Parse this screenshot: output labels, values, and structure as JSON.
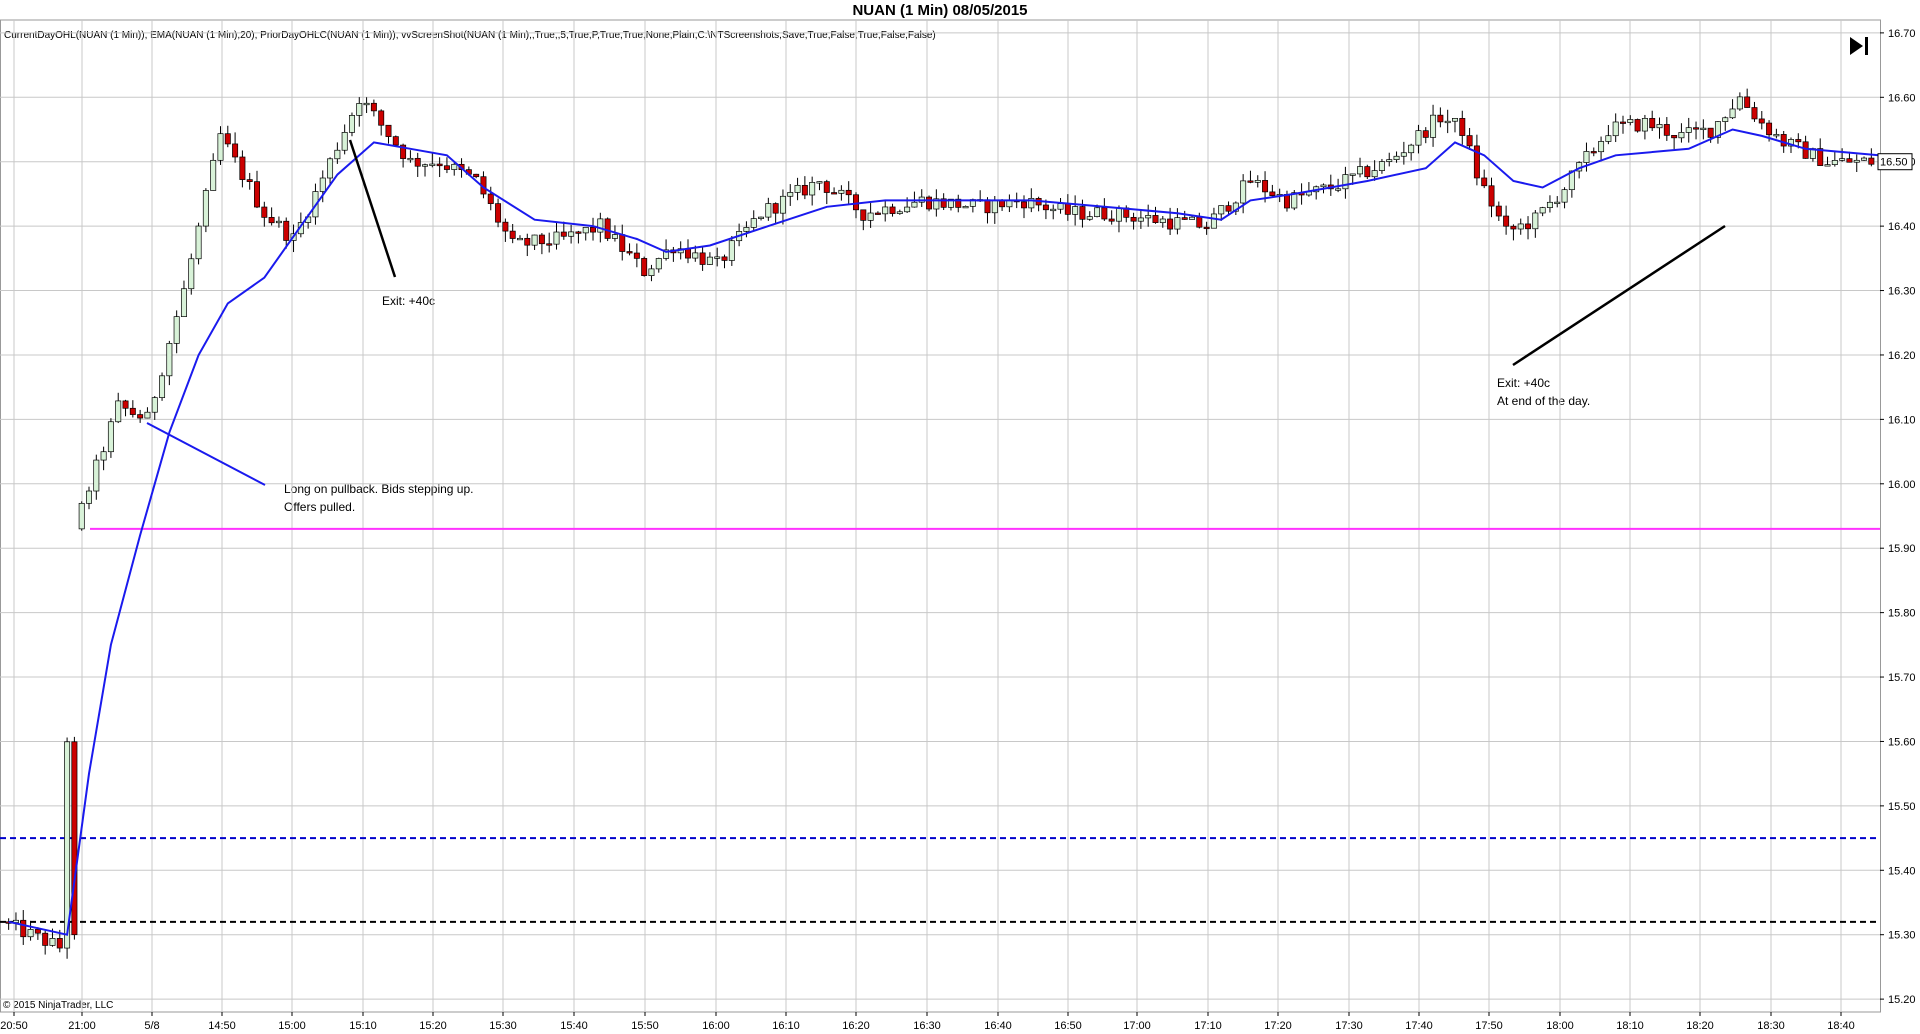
{
  "title": "NUAN (1 Min)  08/05/2015",
  "indicator_legend": "CurrentDayOHL(NUAN (1 Min)), EMA(NUAN (1 Min),20), PriorDayOHLC(NUAN (1 Min)), vvScreenShot(NUAN (1 Min),,True,,5,True,P,True,True,None,Plain,C:\\NTScreenshots,Save,True,False,True,False,False)",
  "copyright": "© 2015 NinjaTrader, LLC",
  "current_price_label": "16.50",
  "nav_icon": "skip-to-end-icon",
  "annotations": {
    "long_entry": [
      "Long on pullback. Bids stepping up.",
      "Offers pulled."
    ],
    "exit_first": [
      "Exit: +40c"
    ],
    "exit_second": [
      "Exit: +40c",
      "At end of the day."
    ]
  },
  "colors": {
    "up_candle": "#d8f2d8",
    "down_candle": "#cc0000",
    "ema": "#1a1aee",
    "current_day_open": "#ff33ff",
    "prior_day_level_blue": "#0000cc",
    "prior_day_level_black": "#000000",
    "grid": "#c8c8c8"
  },
  "chart_data": {
    "type": "candlestick",
    "instrument": "NUAN",
    "interval": "1 Min",
    "date": "08/05/2015",
    "ylim": [
      15.18,
      16.72
    ],
    "y_ticks": [
      15.2,
      15.3,
      15.4,
      15.5,
      15.6,
      15.7,
      15.8,
      15.9,
      16.0,
      16.1,
      16.2,
      16.3,
      16.4,
      16.5,
      16.6,
      16.7
    ],
    "x_tick_labels": [
      "20:50",
      "21:00",
      "5/8",
      "14:50",
      "15:00",
      "15:10",
      "15:20",
      "15:30",
      "15:40",
      "15:50",
      "16:00",
      "16:10",
      "16:20",
      "16:30",
      "16:40",
      "16:50",
      "17:00",
      "17:10",
      "17:20",
      "17:30",
      "17:40",
      "17:50",
      "18:00",
      "18:10",
      "18:20",
      "18:30",
      "18:40"
    ],
    "horizontal_levels": [
      {
        "value": 15.93,
        "style": "solid",
        "color": "#ff33ff"
      },
      {
        "value": 15.45,
        "style": "dashed",
        "color": "#0000cc"
      },
      {
        "value": 15.32,
        "style": "dashed",
        "color": "#000000"
      }
    ],
    "current_price": 16.5,
    "close_path": [
      [
        0,
        15.32
      ],
      [
        8,
        15.28
      ],
      [
        10,
        15.93
      ],
      [
        16,
        16.12
      ],
      [
        20,
        16.1
      ],
      [
        25,
        16.3
      ],
      [
        30,
        16.54
      ],
      [
        36,
        16.42
      ],
      [
        40,
        16.38
      ],
      [
        43,
        16.45
      ],
      [
        49,
        16.6
      ],
      [
        56,
        16.5
      ],
      [
        60,
        16.5
      ],
      [
        65,
        16.47
      ],
      [
        70,
        16.37
      ],
      [
        77,
        16.38
      ],
      [
        82,
        16.4
      ],
      [
        88,
        16.33
      ],
      [
        92,
        16.37
      ],
      [
        98,
        16.34
      ],
      [
        104,
        16.42
      ],
      [
        112,
        16.47
      ],
      [
        118,
        16.42
      ],
      [
        126,
        16.44
      ],
      [
        134,
        16.43
      ],
      [
        140,
        16.44
      ],
      [
        146,
        16.42
      ],
      [
        152,
        16.42
      ],
      [
        158,
        16.41
      ],
      [
        165,
        16.4
      ],
      [
        171,
        16.47
      ],
      [
        176,
        16.44
      ],
      [
        182,
        16.46
      ],
      [
        190,
        16.5
      ],
      [
        197,
        16.57
      ],
      [
        200,
        16.55
      ],
      [
        202,
        16.48
      ],
      [
        206,
        16.39
      ],
      [
        210,
        16.41
      ],
      [
        214,
        16.46
      ],
      [
        220,
        16.55
      ],
      [
        225,
        16.56
      ],
      [
        230,
        16.54
      ],
      [
        234,
        16.55
      ],
      [
        238,
        16.6
      ],
      [
        241,
        16.56
      ],
      [
        244,
        16.53
      ],
      [
        250,
        16.5
      ],
      [
        256,
        16.5
      ]
    ],
    "ema_path": [
      [
        0,
        15.32
      ],
      [
        8,
        15.3
      ],
      [
        11,
        15.55
      ],
      [
        14,
        15.75
      ],
      [
        18,
        15.92
      ],
      [
        22,
        16.08
      ],
      [
        26,
        16.2
      ],
      [
        30,
        16.28
      ],
      [
        35,
        16.32
      ],
      [
        40,
        16.4
      ],
      [
        45,
        16.48
      ],
      [
        50,
        16.53
      ],
      [
        55,
        16.52
      ],
      [
        60,
        16.51
      ],
      [
        65,
        16.46
      ],
      [
        72,
        16.41
      ],
      [
        80,
        16.4
      ],
      [
        86,
        16.38
      ],
      [
        90,
        16.36
      ],
      [
        96,
        16.37
      ],
      [
        104,
        16.4
      ],
      [
        112,
        16.43
      ],
      [
        120,
        16.44
      ],
      [
        130,
        16.44
      ],
      [
        140,
        16.44
      ],
      [
        150,
        16.43
      ],
      [
        160,
        16.42
      ],
      [
        166,
        16.41
      ],
      [
        170,
        16.44
      ],
      [
        176,
        16.45
      ],
      [
        186,
        16.47
      ],
      [
        194,
        16.49
      ],
      [
        198,
        16.53
      ],
      [
        202,
        16.51
      ],
      [
        206,
        16.47
      ],
      [
        210,
        16.46
      ],
      [
        215,
        16.49
      ],
      [
        220,
        16.51
      ],
      [
        230,
        16.52
      ],
      [
        236,
        16.55
      ],
      [
        240,
        16.54
      ],
      [
        246,
        16.52
      ],
      [
        256,
        16.51
      ]
    ]
  }
}
